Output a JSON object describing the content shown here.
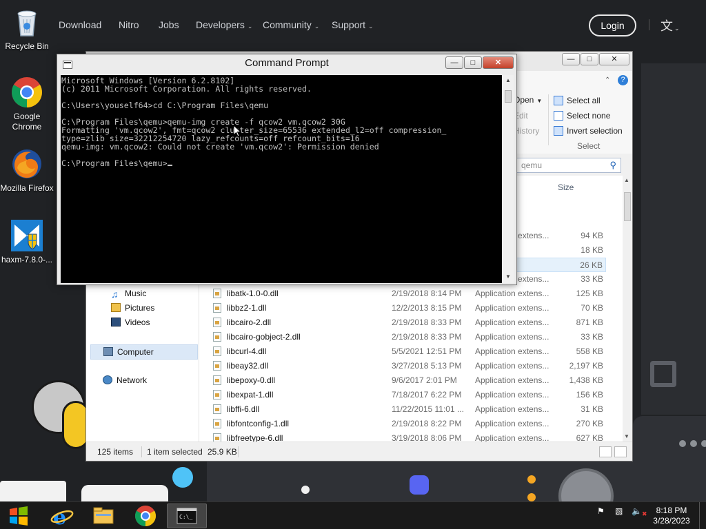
{
  "site_nav": {
    "links": [
      "Download",
      "Nitro",
      "Jobs",
      "Developers",
      "Community",
      "Support"
    ],
    "login": "Login",
    "language_icon": "translate-icon"
  },
  "desktop_icons": [
    {
      "label": "Recycle Bin",
      "icon": "recycle-bin-icon"
    },
    {
      "label": "Google Chrome",
      "icon": "chrome-icon"
    },
    {
      "label": "Mozilla Firefox",
      "icon": "firefox-icon"
    },
    {
      "label": "haxm-7.8.0-...",
      "icon": "haxm-installer-icon"
    }
  ],
  "cmd": {
    "title": "Command Prompt",
    "lines": [
      "Microsoft Windows [Version 6.2.8102]",
      "(c) 2011 Microsoft Corporation. All rights reserved.",
      "",
      "C:\\Users\\youself64>cd C:\\Program Files\\qemu",
      "",
      "C:\\Program Files\\qemu>qemu-img create -f qcow2 vm.qcow2 30G",
      "Formatting 'vm.qcow2', fmt=qcow2 cluster_size=65536 extended_l2=off compression_",
      "type=zlib size=32212254720 lazy_refcounts=off refcount_bits=16",
      "qemu-img: vm.qcow2: Could not create 'vm.qcow2': Permission denied",
      "",
      "C:\\Program Files\\qemu>"
    ]
  },
  "explorer": {
    "ribbon": {
      "open": "Open",
      "edit": "Edit",
      "history": "History",
      "select_all": "Select all",
      "select_none": "Select none",
      "invert_selection": "Invert selection",
      "select_group": "Select"
    },
    "search_placeholder": "qemu",
    "size_header": "Size",
    "nav": {
      "music": "Music",
      "pictures": "Pictures",
      "videos": "Videos",
      "computer": "Computer",
      "network": "Network"
    },
    "partial_rows": [
      {
        "type": "Application extens...",
        "size": "94 KB"
      },
      {
        "type": "",
        "size": "18 KB"
      },
      {
        "type": "",
        "size": "26 KB"
      },
      {
        "type": "Application extens...",
        "size": "33 KB"
      }
    ],
    "files": [
      {
        "name": "libatk-1.0-0.dll",
        "date": "2/19/2018 8:14 PM",
        "type": "Application extens...",
        "size": "125 KB"
      },
      {
        "name": "libbz2-1.dll",
        "date": "12/2/2013 8:15 PM",
        "type": "Application extens...",
        "size": "70 KB"
      },
      {
        "name": "libcairo-2.dll",
        "date": "2/19/2018 8:33 PM",
        "type": "Application extens...",
        "size": "871 KB"
      },
      {
        "name": "libcairo-gobject-2.dll",
        "date": "2/19/2018 8:33 PM",
        "type": "Application extens...",
        "size": "33 KB"
      },
      {
        "name": "libcurl-4.dll",
        "date": "5/5/2021 12:51 PM",
        "type": "Application extens...",
        "size": "558 KB"
      },
      {
        "name": "libeay32.dll",
        "date": "3/27/2018 5:13 PM",
        "type": "Application extens...",
        "size": "2,197 KB"
      },
      {
        "name": "libepoxy-0.dll",
        "date": "9/6/2017 2:01 PM",
        "type": "Application extens...",
        "size": "1,438 KB"
      },
      {
        "name": "libexpat-1.dll",
        "date": "7/18/2017 6:22 PM",
        "type": "Application extens...",
        "size": "156 KB"
      },
      {
        "name": "libffi-6.dll",
        "date": "11/22/2015 11:01 ...",
        "type": "Application extens...",
        "size": "31 KB"
      },
      {
        "name": "libfontconfig-1.dll",
        "date": "2/19/2018 8:22 PM",
        "type": "Application extens...",
        "size": "270 KB"
      },
      {
        "name": "libfreetype-6.dll",
        "date": "3/19/2018 8:06 PM",
        "type": "Application extens...",
        "size": "627 KB"
      }
    ],
    "status": {
      "items": "125 items",
      "selected": "1 item selected",
      "selected_size": "25.9 KB"
    }
  },
  "taskbar": {
    "apps": [
      "start-icon",
      "internet-explorer-icon",
      "file-explorer-icon",
      "chrome-icon",
      "command-prompt-icon"
    ],
    "time": "8:18 PM",
    "date": "3/28/2023"
  },
  "colors": {
    "cmd_background": "#000000",
    "cmd_text": "#c0c0c0",
    "close_button": "#c4412a",
    "page_background": "#202225"
  }
}
